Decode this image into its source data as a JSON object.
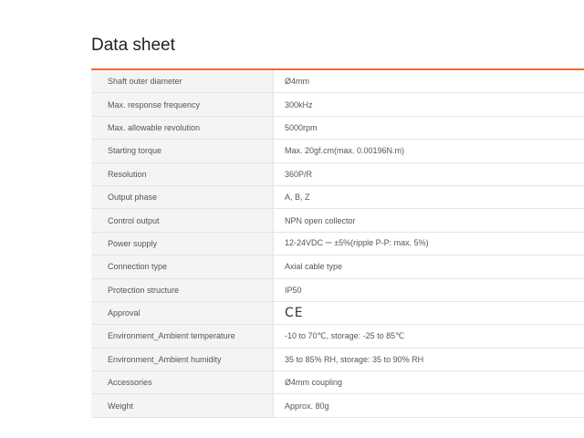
{
  "page": {
    "title": "Data sheet",
    "accent_color": "#e8702a"
  },
  "specs": [
    {
      "label": "Shaft outer diameter",
      "value": "Ø4mm"
    },
    {
      "label": "Max. response frequency",
      "value": "300kHz"
    },
    {
      "label": "Max. allowable revolution",
      "value": "5000rpm"
    },
    {
      "label": "Starting torque",
      "value": "Max. 20gf.cm(max. 0.00196N.m)"
    },
    {
      "label": "Resolution",
      "value": "360P/R"
    },
    {
      "label": "Output phase",
      "value": "A, B, Z"
    },
    {
      "label": "Control output",
      "value": "NPN open collector"
    },
    {
      "label": "Power supply",
      "value": "12-24VDC ⎓ ±5%(ripple P-P: max. 5%)"
    },
    {
      "label": "Connection type",
      "value": "Axial cable type"
    },
    {
      "label": "Protection structure",
      "value": "IP50"
    },
    {
      "label": "Approval",
      "value": "CE",
      "icon": "ce-mark-icon"
    },
    {
      "label": "Environment_Ambient temperature",
      "value": "-10 to 70℃, storage: -25 to 85℃"
    },
    {
      "label": "Environment_Ambient humidity",
      "value": "35 to 85% RH, storage: 35 to 90% RH"
    },
    {
      "label": "Accessories",
      "value": "Ø4mm coupling"
    },
    {
      "label": "Weight",
      "value": "Approx. 80g"
    }
  ]
}
